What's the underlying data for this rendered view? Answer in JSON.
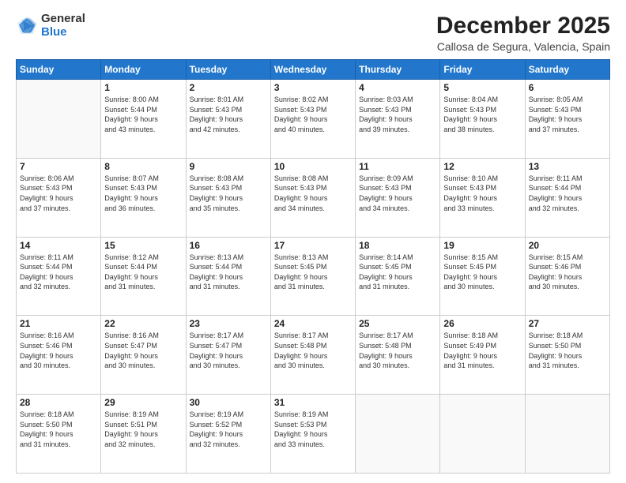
{
  "logo": {
    "general": "General",
    "blue": "Blue"
  },
  "title": "December 2025",
  "location": "Callosa de Segura, Valencia, Spain",
  "days_header": [
    "Sunday",
    "Monday",
    "Tuesday",
    "Wednesday",
    "Thursday",
    "Friday",
    "Saturday"
  ],
  "weeks": [
    [
      {
        "day": "",
        "info": ""
      },
      {
        "day": "1",
        "info": "Sunrise: 8:00 AM\nSunset: 5:44 PM\nDaylight: 9 hours\nand 43 minutes."
      },
      {
        "day": "2",
        "info": "Sunrise: 8:01 AM\nSunset: 5:43 PM\nDaylight: 9 hours\nand 42 minutes."
      },
      {
        "day": "3",
        "info": "Sunrise: 8:02 AM\nSunset: 5:43 PM\nDaylight: 9 hours\nand 40 minutes."
      },
      {
        "day": "4",
        "info": "Sunrise: 8:03 AM\nSunset: 5:43 PM\nDaylight: 9 hours\nand 39 minutes."
      },
      {
        "day": "5",
        "info": "Sunrise: 8:04 AM\nSunset: 5:43 PM\nDaylight: 9 hours\nand 38 minutes."
      },
      {
        "day": "6",
        "info": "Sunrise: 8:05 AM\nSunset: 5:43 PM\nDaylight: 9 hours\nand 37 minutes."
      }
    ],
    [
      {
        "day": "7",
        "info": "Sunrise: 8:06 AM\nSunset: 5:43 PM\nDaylight: 9 hours\nand 37 minutes."
      },
      {
        "day": "8",
        "info": "Sunrise: 8:07 AM\nSunset: 5:43 PM\nDaylight: 9 hours\nand 36 minutes."
      },
      {
        "day": "9",
        "info": "Sunrise: 8:08 AM\nSunset: 5:43 PM\nDaylight: 9 hours\nand 35 minutes."
      },
      {
        "day": "10",
        "info": "Sunrise: 8:08 AM\nSunset: 5:43 PM\nDaylight: 9 hours\nand 34 minutes."
      },
      {
        "day": "11",
        "info": "Sunrise: 8:09 AM\nSunset: 5:43 PM\nDaylight: 9 hours\nand 34 minutes."
      },
      {
        "day": "12",
        "info": "Sunrise: 8:10 AM\nSunset: 5:43 PM\nDaylight: 9 hours\nand 33 minutes."
      },
      {
        "day": "13",
        "info": "Sunrise: 8:11 AM\nSunset: 5:44 PM\nDaylight: 9 hours\nand 32 minutes."
      }
    ],
    [
      {
        "day": "14",
        "info": "Sunrise: 8:11 AM\nSunset: 5:44 PM\nDaylight: 9 hours\nand 32 minutes."
      },
      {
        "day": "15",
        "info": "Sunrise: 8:12 AM\nSunset: 5:44 PM\nDaylight: 9 hours\nand 31 minutes."
      },
      {
        "day": "16",
        "info": "Sunrise: 8:13 AM\nSunset: 5:44 PM\nDaylight: 9 hours\nand 31 minutes."
      },
      {
        "day": "17",
        "info": "Sunrise: 8:13 AM\nSunset: 5:45 PM\nDaylight: 9 hours\nand 31 minutes."
      },
      {
        "day": "18",
        "info": "Sunrise: 8:14 AM\nSunset: 5:45 PM\nDaylight: 9 hours\nand 31 minutes."
      },
      {
        "day": "19",
        "info": "Sunrise: 8:15 AM\nSunset: 5:45 PM\nDaylight: 9 hours\nand 30 minutes."
      },
      {
        "day": "20",
        "info": "Sunrise: 8:15 AM\nSunset: 5:46 PM\nDaylight: 9 hours\nand 30 minutes."
      }
    ],
    [
      {
        "day": "21",
        "info": "Sunrise: 8:16 AM\nSunset: 5:46 PM\nDaylight: 9 hours\nand 30 minutes."
      },
      {
        "day": "22",
        "info": "Sunrise: 8:16 AM\nSunset: 5:47 PM\nDaylight: 9 hours\nand 30 minutes."
      },
      {
        "day": "23",
        "info": "Sunrise: 8:17 AM\nSunset: 5:47 PM\nDaylight: 9 hours\nand 30 minutes."
      },
      {
        "day": "24",
        "info": "Sunrise: 8:17 AM\nSunset: 5:48 PM\nDaylight: 9 hours\nand 30 minutes."
      },
      {
        "day": "25",
        "info": "Sunrise: 8:17 AM\nSunset: 5:48 PM\nDaylight: 9 hours\nand 30 minutes."
      },
      {
        "day": "26",
        "info": "Sunrise: 8:18 AM\nSunset: 5:49 PM\nDaylight: 9 hours\nand 31 minutes."
      },
      {
        "day": "27",
        "info": "Sunrise: 8:18 AM\nSunset: 5:50 PM\nDaylight: 9 hours\nand 31 minutes."
      }
    ],
    [
      {
        "day": "28",
        "info": "Sunrise: 8:18 AM\nSunset: 5:50 PM\nDaylight: 9 hours\nand 31 minutes."
      },
      {
        "day": "29",
        "info": "Sunrise: 8:19 AM\nSunset: 5:51 PM\nDaylight: 9 hours\nand 32 minutes."
      },
      {
        "day": "30",
        "info": "Sunrise: 8:19 AM\nSunset: 5:52 PM\nDaylight: 9 hours\nand 32 minutes."
      },
      {
        "day": "31",
        "info": "Sunrise: 8:19 AM\nSunset: 5:53 PM\nDaylight: 9 hours\nand 33 minutes."
      },
      {
        "day": "",
        "info": ""
      },
      {
        "day": "",
        "info": ""
      },
      {
        "day": "",
        "info": ""
      }
    ]
  ]
}
